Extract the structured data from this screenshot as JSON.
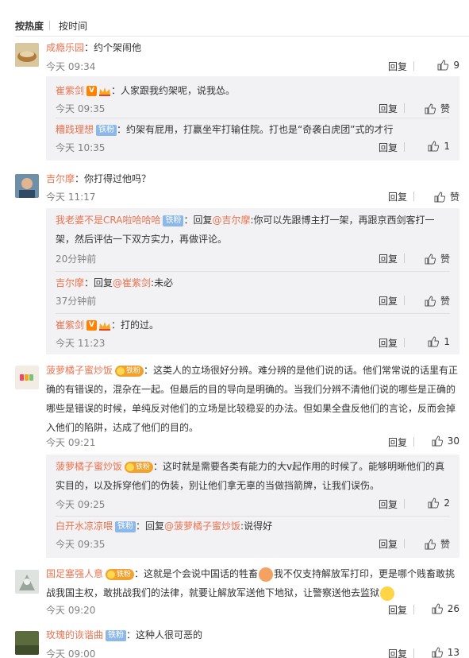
{
  "sort": {
    "hot": "按热度",
    "time": "按时间"
  },
  "labels": {
    "reply": "回复",
    "like": "赞",
    "fan_badge": "铁粉",
    "v": "V"
  },
  "comments": [
    {
      "user": "成瘾乐园",
      "text": "：约个架闹他",
      "time": "今天 09:34",
      "likes": "9",
      "replies": [
        {
          "user": "崔紫剑",
          "text": "：人家跟我约架呢，说我怂。",
          "time": "今天 09:35",
          "likes": "赞"
        },
        {
          "user": "糟践理想",
          "text": "：约架有屁用，打赢坐牢打输住院。打也是“奇袭白虎团”式的才行",
          "time": "今天 10:35",
          "likes": "1"
        }
      ]
    },
    {
      "user": "吉尔摩",
      "text": "：你打得过他吗？",
      "time": "今天 11:17",
      "likes": "赞",
      "replies": [
        {
          "user": "我老婆不是CRA啦哈哈哈",
          "prefix": "：回复",
          "mention": "@吉尔摩",
          "text": ":你可以先跟博主打一架，再跟京西剑客打一架，然后评估一下双方实力，再做评论。",
          "time": "20分钟前",
          "likes": "赞"
        },
        {
          "user": "吉尔摩",
          "prefix": "：回复",
          "mention": "@崔紫剑",
          "text": ":未必",
          "time": "37分钟前",
          "likes": "赞"
        },
        {
          "user": "崔紫剑",
          "text": "：打的过。",
          "time": "今天 11:23",
          "likes": "1"
        }
      ]
    },
    {
      "user": "菠萝橘子蜜炒饭",
      "text": "：这类人的立场很好分辨。难分辨的是他们说的话。他们常常说的话里有正确的有错误的，混杂在一起。但最后的目的导向是明确的。当我们分辨不清他们说的哪些是正确的哪些是错误的时候，单纯反对他们的立场是比较稳妥的办法。但如果全盘反他们的言论，反而会掉入他们的陷阱，达成了他们的目的。",
      "time": "今天 09:21",
      "likes": "30",
      "replies": [
        {
          "user": "菠萝橘子蜜炒饭",
          "text": "：这时就是需要各类有能力的大v起作用的时候了。能够明晰他们的真实目的，以及拆穿他们的伪装，别让他们拿无辜的当做挡箭牌，让我们误伤。",
          "time": "今天 09:25",
          "likes": "2"
        },
        {
          "user": "白开水凉凉喂",
          "prefix": "：回复",
          "mention": "@菠萝橘子蜜炒饭",
          "text": ":说得好",
          "time": "今天 09:35",
          "likes": "赞"
        }
      ]
    },
    {
      "user": "国足塞强人意",
      "text": "：这就是个会说中国话的牲畜",
      "text2": "我不仅支持解放军打印，更是哪个贱畜敢挑战我国主权，敢挑战我们的法律，就要让解放军送他下地狱，让警察送他去监狱",
      "time": "今天 09:20",
      "likes": "26"
    },
    {
      "user": "玫瑰的诙谐曲",
      "text": "：这种人很可恶的",
      "time": "今天 09:00",
      "likes": "13"
    }
  ],
  "colors": {
    "link": "#eb7350",
    "meta": "#808080",
    "reply_bg": "#f2f2f5",
    "fan_badge": "#8bb8e8",
    "v_badge": "#ff8200"
  },
  "icons": [
    "thumb-up-icon",
    "v-verified-icon",
    "crown-icon",
    "level-badge-icon",
    "sweat-emoji-icon",
    "smile-emoji-icon"
  ]
}
